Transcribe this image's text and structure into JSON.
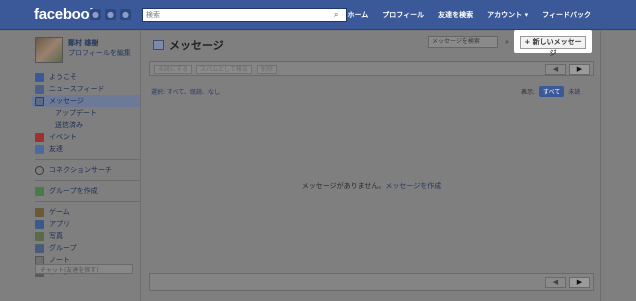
{
  "topbar": {
    "logo": "facebook",
    "search_placeholder": "検索",
    "nav": [
      "ホーム",
      "プロフィール",
      "友達を検索",
      "アカウント ▾",
      "フィードバック"
    ]
  },
  "profile": {
    "name": "鄭村 雄樹",
    "edit": "プロフィールを編集"
  },
  "sidebar": {
    "items": [
      {
        "label": "ようこそ",
        "icon": "facebook-icon",
        "color": "#3b5998"
      },
      {
        "label": "ニュースフィード",
        "icon": "newsfeed-icon",
        "color": "#4a5f8a"
      },
      {
        "label": "メッセージ",
        "icon": "messages-icon",
        "color": "#5a6a8a"
      },
      {
        "label": "アップデート",
        "sub": true
      },
      {
        "label": "送信済み",
        "sub": true
      },
      {
        "label": "イベント",
        "icon": "events-icon",
        "color": "#a03030"
      },
      {
        "label": "友達",
        "icon": "friends-icon",
        "color": "#4a6aa0"
      }
    ],
    "connect": "コネクションサーチ",
    "create_group": "グループを作成",
    "apps": [
      {
        "label": "ゲーム",
        "icon": "games-icon",
        "color": "#6a5a3a"
      },
      {
        "label": "アプリ",
        "icon": "apps-icon",
        "color": "#3a5a8a"
      },
      {
        "label": "写真",
        "icon": "photos-icon",
        "color": "#5a6a4a"
      },
      {
        "label": "グループ",
        "icon": "groups-icon",
        "color": "#4a5a7a"
      },
      {
        "label": "ノート",
        "icon": "notes-icon",
        "color": "#707070"
      },
      {
        "label": "リンク",
        "icon": "links-icon",
        "color": "#5a5a5a"
      }
    ],
    "chat_search": "チャット(友達を探す)"
  },
  "main": {
    "title": "メッセージ",
    "search_placeholder": "メッセージを検索",
    "new_message": "+ 新しいメッセージ",
    "actions": [
      "未読にする",
      "スパムとして報告",
      "削除"
    ],
    "filter": "選択: すべて、既読、なし",
    "show_label": "表示:",
    "show_all": "すべて",
    "show_unread": "未読",
    "empty_text": "メッセージがありません。",
    "empty_link": "メッセージを作成",
    "prev": "◀",
    "next": "▶"
  }
}
